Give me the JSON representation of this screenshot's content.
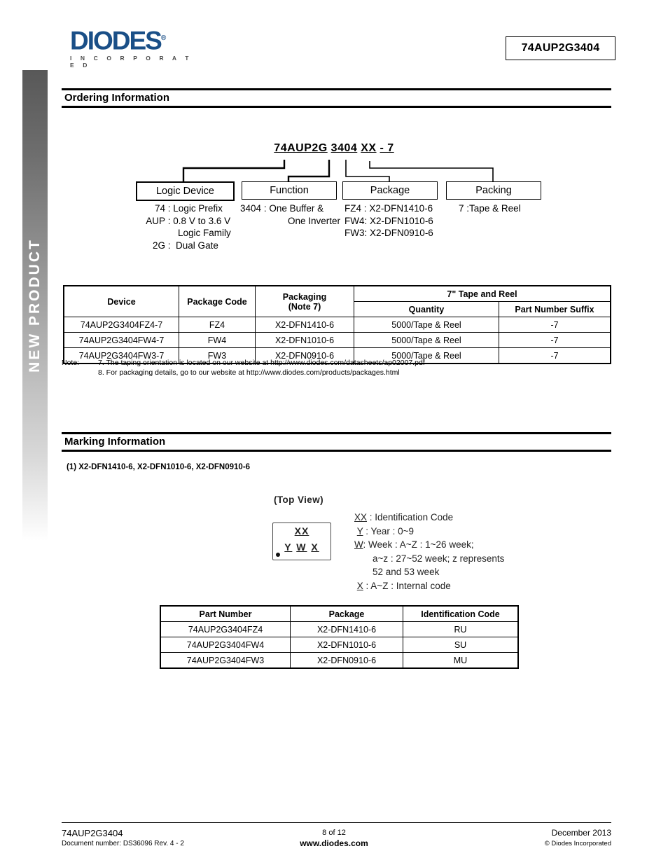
{
  "header": {
    "logo_word": "DIODES",
    "logo_reg": "®",
    "logo_sub": "I N C O R P O R A T E D",
    "part_number": "74AUP2G3404"
  },
  "sidebar": {
    "label": "NEW PRODUCT"
  },
  "sections": {
    "ordering_title": "Ordering Information",
    "marking_title": "Marking Information"
  },
  "ordering_diagram": {
    "title_parts": {
      "p1": "74AUP2G",
      "p2": "3404",
      "p3": "XX",
      "p4": "- 7"
    },
    "boxes": [
      {
        "label": "Logic Device"
      },
      {
        "label": "Function"
      },
      {
        "label": "Package"
      },
      {
        "label": "Packing"
      }
    ],
    "captions": {
      "logic_device": [
        {
          "key": "74",
          "sep": ":",
          "val": "Logic Prefix"
        },
        {
          "key": "AUP",
          "sep": ":",
          "val": "0.8 V to 3.6 V"
        },
        {
          "key": "",
          "sep": "",
          "val": "Logic Family"
        },
        {
          "key": "2G",
          "sep": ":",
          "val": "Dual Gate"
        }
      ],
      "function": [
        {
          "key": "3404",
          "sep": ":",
          "val": "One Buffer &"
        },
        {
          "key": "",
          "sep": "",
          "val": "One Inverter"
        }
      ],
      "package": [
        {
          "key": "FZ4",
          "sep": ":",
          "val": "X2-DFN1410-6"
        },
        {
          "key": "FW4",
          "sep": ":",
          "val": "X2-DFN1010-6"
        },
        {
          "key": "FW3",
          "sep": ":",
          "val": "X2-DFN0910-6"
        }
      ],
      "packing": [
        {
          "key": "7",
          "sep": ":",
          "val": "Tape & Reel"
        }
      ]
    }
  },
  "ordering_table": {
    "headers": {
      "device": "Device",
      "package_code": "Package Code",
      "packaging_line1": "Packaging",
      "packaging_line2": "(Note 7)",
      "tape_reel": "7\" Tape and Reel",
      "quantity": "Quantity",
      "suffix": "Part Number Suffix"
    },
    "rows": [
      {
        "device": "74AUP2G3404FZ4-7",
        "package_code": "FZ4",
        "packaging": "X2-DFN1410-6",
        "quantity": "5000/Tape & Reel",
        "suffix": "-7"
      },
      {
        "device": "74AUP2G3404FW4-7",
        "package_code": "FW4",
        "packaging": "X2-DFN1010-6",
        "quantity": "5000/Tape & Reel",
        "suffix": "-7"
      },
      {
        "device": "74AUP2G3404FW3-7",
        "package_code": "FW3",
        "packaging": "X2-DFN0910-6",
        "quantity": "5000/Tape & Reel",
        "suffix": "-7"
      }
    ]
  },
  "notes": {
    "label": "Note:",
    "line7": "7. The taping orientation is located on our website at http://www.diodes.com/datasheets/ap02007.pdf",
    "line8": "8. For packaging details, go to our website at http://www.diodes.com/products/packages.html"
  },
  "marking": {
    "package_note": "(1) X2-DFN1410-6, X2-DFN1010-6, X2-DFN0910-6",
    "top_view": "(Top View)",
    "chip_line1": "XX",
    "chip_line2_y": "Y",
    "chip_line2_w": "W",
    "chip_line2_x": "X",
    "legend": {
      "l1_key": "XX",
      "l1_val": ": Identification Code",
      "l2_key": "Y",
      "l2_val": ": Year : 0~9",
      "l3_key": "W",
      "l3_val": ": Week : A~Z : 1~26 week;",
      "l4_val": "a~z : 27~52 week; z represents",
      "l5_val": "52 and 53 week",
      "l6_key": "X",
      "l6_val": ": A~Z : Internal code"
    }
  },
  "marking_table": {
    "headers": {
      "part_number": "Part Number",
      "package": "Package",
      "id_code": "Identification Code"
    },
    "rows": [
      {
        "part_number": "74AUP2G3404FZ4",
        "package": "X2-DFN1410-6",
        "id_code": "RU"
      },
      {
        "part_number": "74AUP2G3404FW4",
        "package": "X2-DFN1010-6",
        "id_code": "SU"
      },
      {
        "part_number": "74AUP2G3404FW3",
        "package": "X2-DFN0910-6",
        "id_code": "MU"
      }
    ]
  },
  "footer": {
    "left_line1": "74AUP2G3404",
    "left_line2": "Document number: DS36096   Rev. 4 - 2",
    "center_line1": "8 of 12",
    "center_line2": "www.diodes.com",
    "right_line1": "December 2013",
    "right_line2": "© Diodes Incorporated"
  },
  "colors": {
    "brand_blue": "#1a4f87",
    "sidebar_dark": "#585858",
    "rule": "#000000"
  }
}
